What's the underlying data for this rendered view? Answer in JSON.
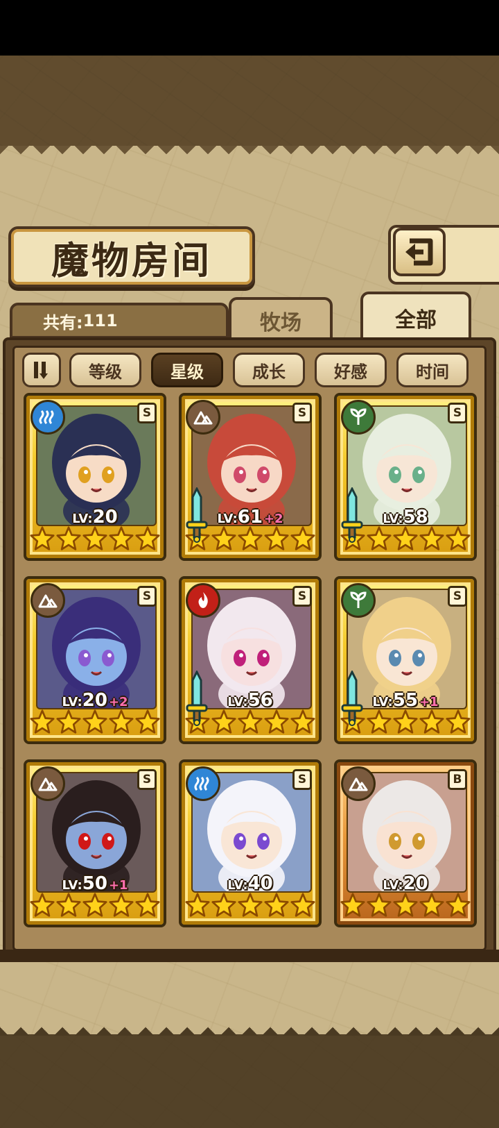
{
  "header": {
    "title": "魔物房间"
  },
  "summary": {
    "count_label": "共有:",
    "count_value": "111"
  },
  "tabs": [
    {
      "label": "牧场",
      "active": false
    },
    {
      "label": "全部",
      "active": true
    }
  ],
  "filters": [
    {
      "label": "等级",
      "active": false
    },
    {
      "label": "星级",
      "active": true
    },
    {
      "label": "成长",
      "active": false
    },
    {
      "label": "好感",
      "active": false
    },
    {
      "label": "时间",
      "active": false
    }
  ],
  "monsters": [
    {
      "element": "water",
      "rank": "S",
      "level": "20",
      "bonus": "",
      "stars": 5,
      "weapon": false,
      "frame": "gold",
      "hair": "#2a3054",
      "skin": "#f7dcc6",
      "eye": "#e0a020",
      "bg": "#6a7a5a"
    },
    {
      "element": "earth",
      "rank": "S",
      "level": "61",
      "bonus": "+2",
      "stars": 5,
      "weapon": true,
      "frame": "gold",
      "hair": "#c84a3a",
      "skin": "#f7d8c6",
      "eye": "#d04a6a",
      "bg": "#8a6a4a"
    },
    {
      "element": "plant",
      "rank": "S",
      "level": "58",
      "bonus": "",
      "stars": 5,
      "weapon": true,
      "frame": "gold",
      "hair": "#e8eee0",
      "skin": "#f7e6d6",
      "eye": "#6ab08a",
      "bg": "#b8c8a0"
    },
    {
      "element": "earth",
      "rank": "S",
      "level": "20",
      "bonus": "+2",
      "stars": 5,
      "weapon": false,
      "frame": "gold",
      "hair": "#3a2e7a",
      "skin": "#8ab0e8",
      "eye": "#8a5ad0",
      "bg": "#5a5a8a"
    },
    {
      "element": "fire",
      "rank": "S",
      "level": "56",
      "bonus": "",
      "stars": 5,
      "weapon": true,
      "frame": "gold",
      "hair": "#f2e8ee",
      "skin": "#f7e0e0",
      "eye": "#c0207a",
      "bg": "#8a6a7a"
    },
    {
      "element": "plant",
      "rank": "S",
      "level": "55",
      "bonus": "+1",
      "stars": 5,
      "weapon": true,
      "frame": "gold",
      "hair": "#f0d08a",
      "skin": "#f9e6d4",
      "eye": "#5a8ab0",
      "bg": "#c8b080"
    },
    {
      "element": "earth",
      "rank": "S",
      "level": "50",
      "bonus": "+1",
      "stars": 5,
      "weapon": false,
      "frame": "gold",
      "hair": "#2a1e1e",
      "skin": "#8aa6d8",
      "eye": "#d01818",
      "bg": "#6a5a5a"
    },
    {
      "element": "water",
      "rank": "S",
      "level": "40",
      "bonus": "",
      "stars": 5,
      "weapon": false,
      "frame": "gold",
      "hair": "#f4f4fa",
      "skin": "#f9e6d6",
      "eye": "#7a4ad0",
      "bg": "#8aa0c8"
    },
    {
      "element": "earth",
      "rank": "B",
      "level": "20",
      "bonus": "",
      "stars": 5,
      "weapon": false,
      "frame": "bronze",
      "hair": "#ece8e6",
      "skin": "#f9e2d2",
      "eye": "#d09a30",
      "bg": "#c8a090"
    }
  ]
}
